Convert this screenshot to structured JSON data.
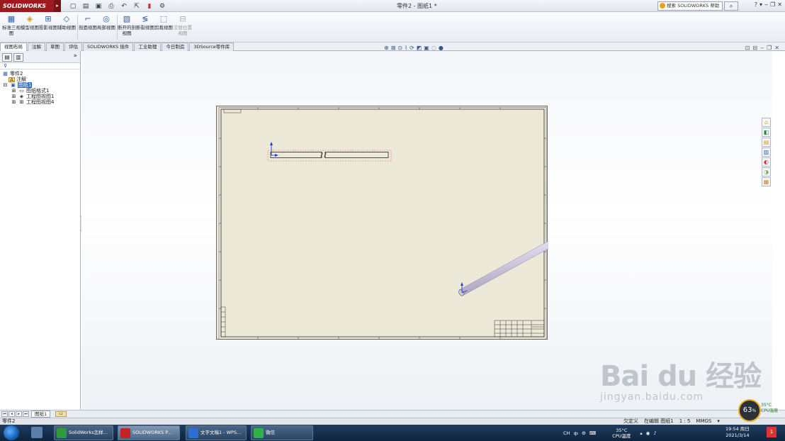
{
  "app": {
    "logo": "SOLIDWORKS",
    "window_title": "零件2 - 图纸1 *"
  },
  "help_search": {
    "placeholder": "搜索 SOLIDWORKS 帮助"
  },
  "window_controls": [
    "?",
    "▾",
    "‒",
    "❐",
    "✕"
  ],
  "quick_access": [
    "new-icon",
    "open-icon",
    "save-icon",
    "print-icon",
    "undo-icon",
    "select-icon",
    "rebuild-icon",
    "options-icon"
  ],
  "command_manager": [
    {
      "label": "标准三视图",
      "icon": "standard-3-view-icon",
      "enabled": true
    },
    {
      "label": "模型视图",
      "icon": "model-view-icon",
      "enabled": true
    },
    {
      "label": "投影视图",
      "icon": "projected-view-icon",
      "enabled": true
    },
    {
      "label": "辅助视图",
      "icon": "auxiliary-view-icon",
      "enabled": true
    },
    {
      "label": "剖面视图",
      "icon": "section-view-icon",
      "enabled": true
    },
    {
      "label": "局部视图",
      "icon": "detail-view-icon",
      "enabled": true
    },
    {
      "label": "断开的剖视图",
      "icon": "broken-out-section-icon",
      "enabled": true
    },
    {
      "label": "断裂视图",
      "icon": "break-view-icon",
      "enabled": true
    },
    {
      "label": "剪裁视图",
      "icon": "crop-view-icon",
      "enabled": true
    },
    {
      "label": "交替位置视图",
      "icon": "alternate-position-icon",
      "enabled": false
    }
  ],
  "tabs": [
    "视图布局",
    "注解",
    "草图",
    "评估",
    "SOLIDWORKS 插件",
    "工业助理",
    "今日制造",
    "3DSource零件库"
  ],
  "active_tab": "视图布局",
  "feature_tree": {
    "root": "零件2",
    "annotations": "注解",
    "sheet": "图纸1",
    "children": [
      "图纸格式1",
      "工程图视图1",
      "工程图视图4"
    ]
  },
  "sheet_tab": "图纸1",
  "status_bar": {
    "left": "零件2",
    "items": [
      "欠定义",
      "在编辑 图纸1",
      "1 : 5",
      "MMGS",
      "▾"
    ]
  },
  "taskbar": {
    "tasks": [
      {
        "label": "SolidWorks怎样...",
        "color": "#2f9b3a",
        "active": false
      },
      {
        "label": "SOLIDWORKS P...",
        "color": "#c8202a",
        "active": true
      },
      {
        "label": "文字文稿1 - WPS...",
        "color": "#2a6fd1",
        "active": false
      },
      {
        "label": "微信",
        "color": "#2fb24a",
        "active": false
      }
    ],
    "tray_text": [
      "CH",
      "中",
      "35°C",
      "CPU温度"
    ],
    "time": "19:54 周日",
    "date": "2021/3/14",
    "notifications": "1"
  },
  "cpu_monitor": {
    "percent": "63",
    "unit": "%",
    "temp": "35°C",
    "label": "CPU温度"
  },
  "watermark": {
    "main": "Bai du 经验",
    "sub": "jingyan.baidu.com"
  },
  "colors": {
    "sheet": "#ede9d8",
    "brand": "#9e1a1e",
    "selection": "#316ac5",
    "taskbar": "#1f3c5e"
  }
}
